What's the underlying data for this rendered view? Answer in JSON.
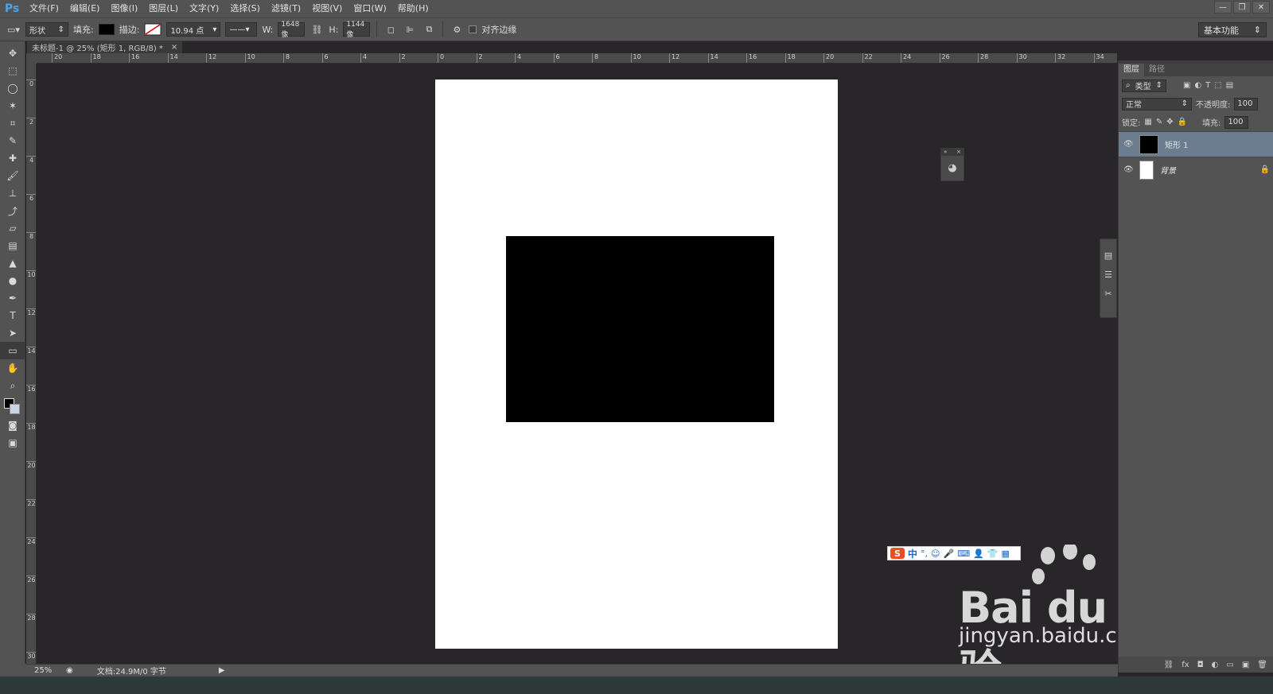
{
  "app": {
    "logo": "Ps"
  },
  "menu": [
    "文件(F)",
    "编辑(E)",
    "图像(I)",
    "图层(L)",
    "文字(Y)",
    "选择(S)",
    "滤镜(T)",
    "视图(V)",
    "窗口(W)",
    "帮助(H)"
  ],
  "window_controls": [
    "—",
    "❐",
    "✕"
  ],
  "options": {
    "shape_mode": "形状",
    "fill_label": "填充:",
    "fill_color": "#000000",
    "stroke_label": "描边:",
    "stroke_size": "10.94 点",
    "w_label": "W:",
    "w_value": "1648 像",
    "h_label": "H:",
    "h_value": "1144 像",
    "align_edges_label": "对齐边缘",
    "workspace": "基本功能"
  },
  "document_tab": {
    "title": "未标题-1 @ 25% (矩形 1, RGB/8) *",
    "close": "×"
  },
  "ruler_h": [
    "20",
    "18",
    "16",
    "14",
    "12",
    "10",
    "8",
    "6",
    "4",
    "2",
    "0",
    "2",
    "4",
    "6",
    "8",
    "10",
    "12",
    "14",
    "16",
    "18",
    "20",
    "22",
    "24",
    "26",
    "28",
    "30",
    "32",
    "34"
  ],
  "ruler_v": [
    "0",
    "2",
    "4",
    "6",
    "8",
    "10",
    "12",
    "14",
    "16",
    "18",
    "20",
    "22",
    "24",
    "26",
    "28",
    "30"
  ],
  "canvas": {
    "background": "#282629",
    "document_color": "#ffffff",
    "shape_color": "#000000"
  },
  "ime": {
    "logo": "S",
    "lang": "中",
    "icons": [
      "°,",
      "☺",
      "🎤",
      "⌨",
      "👤",
      "👕",
      "▦"
    ]
  },
  "watermark": {
    "brand": "Bai du 经验",
    "url": "jingyan.baidu.com"
  },
  "layers": {
    "tabs": [
      "图层",
      "路径"
    ],
    "filter_kind": "类型",
    "blend_mode": "正常",
    "opacity_label": "不透明度:",
    "opacity_value": "100",
    "lock_label": "锁定:",
    "fill_label": "填充:",
    "fill_value": "100",
    "items": [
      {
        "name": "矩形 1",
        "selected": true,
        "thumb_color": "#000000"
      },
      {
        "name": "背景",
        "selected": false,
        "thumb_color": "#ffffff"
      }
    ],
    "footer_icons": [
      "⛓",
      "fx",
      "◘",
      "◐",
      "▭",
      "▣",
      "🗑"
    ]
  },
  "status": {
    "zoom": "25%",
    "doc_info": "文档:24.9M/0 字节"
  }
}
